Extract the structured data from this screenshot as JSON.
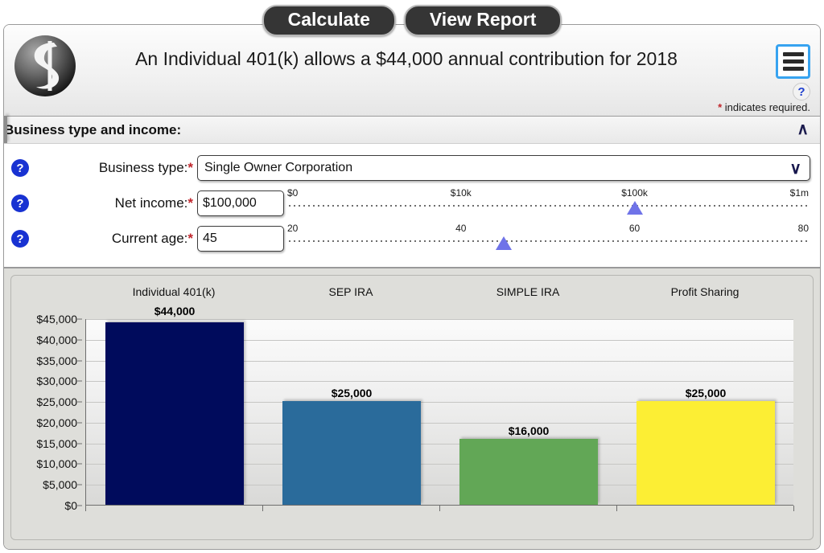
{
  "toolbar": {
    "calculate_label": "Calculate",
    "view_report_label": "View Report"
  },
  "header": {
    "logo_name": "company-sphere-logo",
    "title": "An Individual 401(k) allows a $44,000 annual contribution for 2018",
    "menu_icon": "hamburger-menu-icon",
    "help_icon": "question-mark-icon",
    "help_label": "?",
    "required_star": "*",
    "required_note": " indicates required."
  },
  "section": {
    "title": "Business type and income:",
    "collapse_chevron": "∧",
    "help_badge_label": "?",
    "rows": [
      {
        "label": "Business type:",
        "star": "*",
        "control": "select",
        "value": "Single Owner Corporation",
        "caret": "∨"
      },
      {
        "label": "Net income:",
        "star": "*",
        "control": "text-slider",
        "value": "$100,000",
        "slider": {
          "ticks": [
            "$0",
            "$10k",
            "$100k",
            "$1m"
          ],
          "tick_positions": [
            0,
            33.3,
            66.6,
            100
          ],
          "thumb_position": 66.6
        }
      },
      {
        "label": "Current age:",
        "star": "*",
        "control": "text-slider",
        "value": "45",
        "slider": {
          "ticks": [
            "20",
            "40",
            "60",
            "80"
          ],
          "tick_positions": [
            0,
            33.3,
            66.6,
            100
          ],
          "thumb_position": 41.5
        }
      }
    ]
  },
  "chart_panel": {
    "collapse_chevron": "∧"
  },
  "chart_data": {
    "type": "bar",
    "title": "",
    "xlabel": "",
    "ylabel": "",
    "categories": [
      "Individual 401(k)",
      "SEP IRA",
      "SIMPLE IRA",
      "Profit Sharing"
    ],
    "values": [
      44000,
      25000,
      16000,
      25000
    ],
    "value_labels": [
      "$44,000",
      "$25,000",
      "$16,000",
      "$25,000"
    ],
    "colors": [
      "#000b5c",
      "#2a6b9b",
      "#62a756",
      "#fcee34"
    ],
    "ylim": [
      0,
      45000
    ],
    "ytick_values": [
      0,
      5000,
      10000,
      15000,
      20000,
      25000,
      30000,
      35000,
      40000,
      45000
    ],
    "ytick_labels": [
      "$0",
      "$5,000",
      "$10,000",
      "$15,000",
      "$20,000",
      "$25,000",
      "$30,000",
      "$35,000",
      "$40,000",
      "$45,000"
    ],
    "grid": true,
    "legend": false
  }
}
